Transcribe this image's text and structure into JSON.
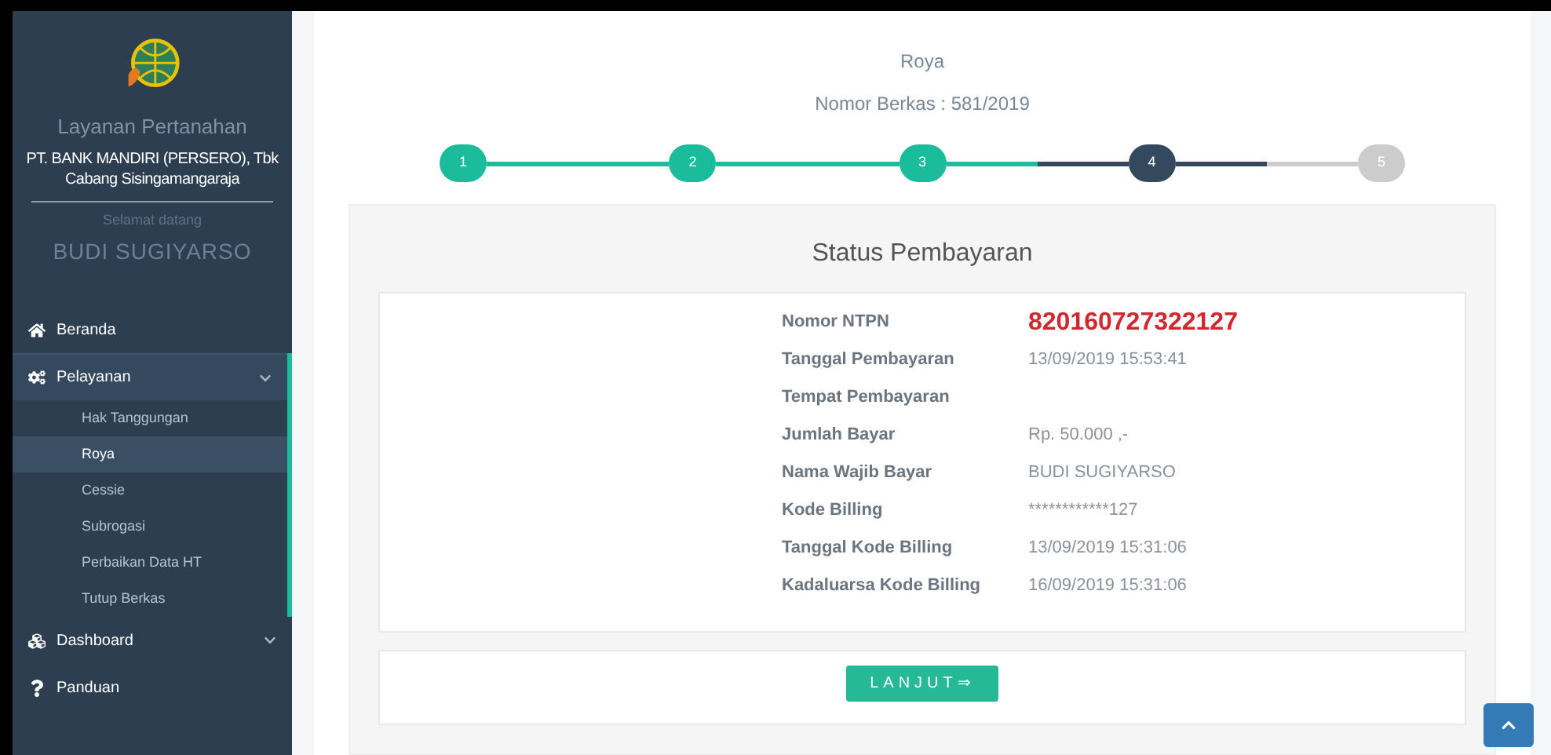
{
  "sidebar": {
    "app_title": "Layanan Pertanahan",
    "organization": "PT. BANK MANDIRI (PERSERO), Tbk Cabang Sisingamangaraja",
    "welcome": "Selamat datang",
    "user_name": "BUDI SUGIYARSO",
    "menu": [
      {
        "label": "Beranda"
      },
      {
        "label": "Pelayanan",
        "expanded": true,
        "children": [
          {
            "label": "Hak Tanggungan",
            "selected": false
          },
          {
            "label": "Roya",
            "selected": true
          },
          {
            "label": "Cessie",
            "selected": false
          },
          {
            "label": "Subrogasi",
            "selected": false
          },
          {
            "label": "Perbaikan Data HT",
            "selected": false
          },
          {
            "label": "Tutup Berkas",
            "selected": false
          }
        ]
      },
      {
        "label": "Dashboard",
        "expanded": false
      },
      {
        "label": "Panduan"
      }
    ]
  },
  "header": {
    "title": "Roya",
    "file_number": "Nomor Berkas : 581/2019"
  },
  "steps": [
    {
      "label": "1",
      "done": true,
      "selected": false
    },
    {
      "label": "2",
      "done": true,
      "selected": false
    },
    {
      "label": "3",
      "done": true,
      "selected": false
    },
    {
      "label": "4",
      "done": false,
      "selected": true
    },
    {
      "label": "5",
      "done": false,
      "selected": false
    }
  ],
  "panel": {
    "title": "Status Pembayaran",
    "fields": [
      {
        "label": "Nomor NTPN",
        "value": "820160727322127",
        "highlighted": true
      },
      {
        "label": "Tanggal Pembayaran",
        "value": "13/09/2019 15:53:41",
        "highlighted": false
      },
      {
        "label": "Tempat Pembayaran"
      },
      {
        "label": "Jumlah Bayar",
        "value": "Rp. 50.000 ,-",
        "highlighted": false
      },
      {
        "label": "Nama Wajib Bayar",
        "value": "BUDI SUGIYARSO",
        "highlighted": false
      },
      {
        "label": "Kode Billing",
        "value": "************127",
        "highlighted": false
      },
      {
        "label": "Tanggal Kode Billing",
        "value": "13/09/2019 15:31:06",
        "highlighted": false
      },
      {
        "label": "Kadaluarsa Kode Billing",
        "value": "16/09/2019 15:31:06",
        "highlighted": false
      }
    ],
    "next_button": "LANJUT⇒"
  }
}
